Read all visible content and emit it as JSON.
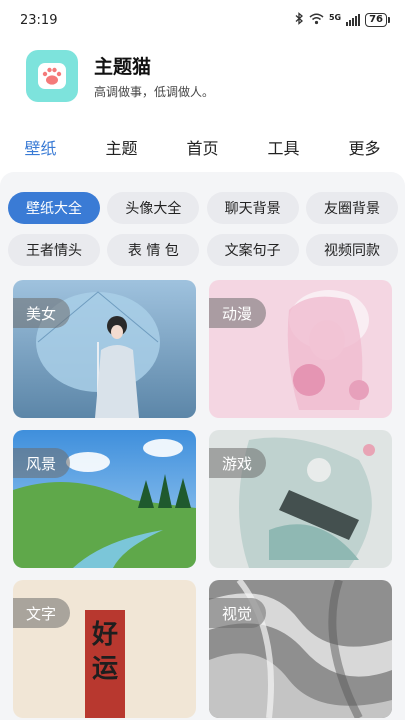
{
  "status": {
    "time": "23:19",
    "network": "5G",
    "battery": "76"
  },
  "app": {
    "title": "主题猫",
    "slogan": "高调做事，低调做人。",
    "logo_icon": "paw-icon",
    "logo_color": "#7de3dc"
  },
  "tabs": [
    {
      "label": "壁纸",
      "active": true
    },
    {
      "label": "主题"
    },
    {
      "label": "首页"
    },
    {
      "label": "工具"
    },
    {
      "label": "更多"
    }
  ],
  "chips": [
    [
      "壁纸大全",
      "头像大全",
      "聊天背景",
      "友圈背景"
    ],
    [
      "王者情头",
      "表 情 包",
      "文案句子",
      "视频同款"
    ]
  ],
  "cards": [
    {
      "label": "美女"
    },
    {
      "label": "动漫"
    },
    {
      "label": "风景"
    },
    {
      "label": "游戏"
    },
    {
      "label": "文字",
      "art_text": "好运"
    },
    {
      "label": "视觉"
    }
  ],
  "colors": {
    "accent": "#3a7bd5",
    "chip_bg": "#e9eaee",
    "content_bg": "#f4f5f7"
  }
}
